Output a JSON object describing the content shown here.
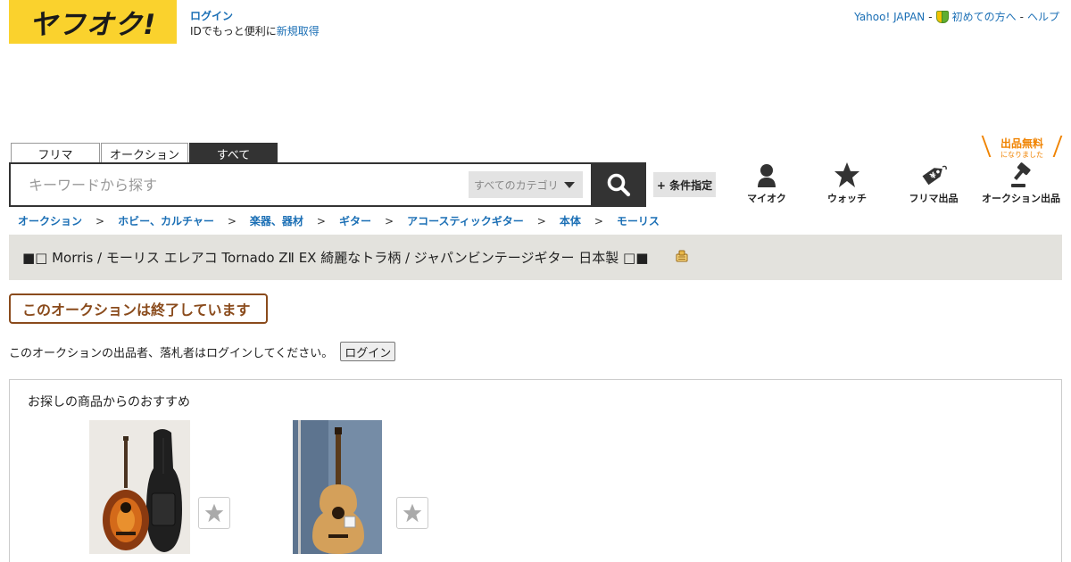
{
  "header": {
    "logo_text": "ヤフオク!",
    "login_label": "ログイン",
    "login_desc": "IDでもっと便利に",
    "register_label": "新規取得",
    "links": [
      "Yahoo! JAPAN",
      "初めての方へ",
      "ヘルプ"
    ],
    "link_sep": "-"
  },
  "search": {
    "tabs": [
      "フリマ",
      "オークション",
      "すべて"
    ],
    "active_tab": "すべて",
    "placeholder": "キーワードから探す",
    "category_label": "すべてのカテゴリ",
    "condition_label": "+ 条件指定"
  },
  "nav": [
    {
      "label": "マイオク",
      "icon": "user-icon"
    },
    {
      "label": "ウォッチ",
      "icon": "star-icon"
    },
    {
      "label": "フリマ出品",
      "icon": "price-tag-icon"
    },
    {
      "label": "オークション出品",
      "icon": "gavel-icon"
    }
  ],
  "free_badge": {
    "main": "出品無料",
    "sub": "になりました"
  },
  "breadcrumb": [
    "オークション",
    "ホビー、カルチャー",
    "楽器、器材",
    "ギター",
    "アコースティックギター",
    "本体",
    "モーリス"
  ],
  "breadcrumb_sep": ">",
  "item": {
    "title": "■□ Morris / モーリス エレアコ Tornado ZⅡ EX 綺麗なトラ柄 / ジャパンビンテージギター 日本製 □■"
  },
  "ended_label": "このオークションは終了しています",
  "login_notice": {
    "text": "このオークションの出品者、落札者はログインしてください。",
    "button": "ログイン"
  },
  "recommend": {
    "title": "お探しの商品からのおすすめ"
  },
  "colors": {
    "brand_yellow": "#fad22d",
    "link_blue": "#1b6fb5",
    "ended_brown": "#8a4b1c",
    "free_orange": "#f08300"
  }
}
